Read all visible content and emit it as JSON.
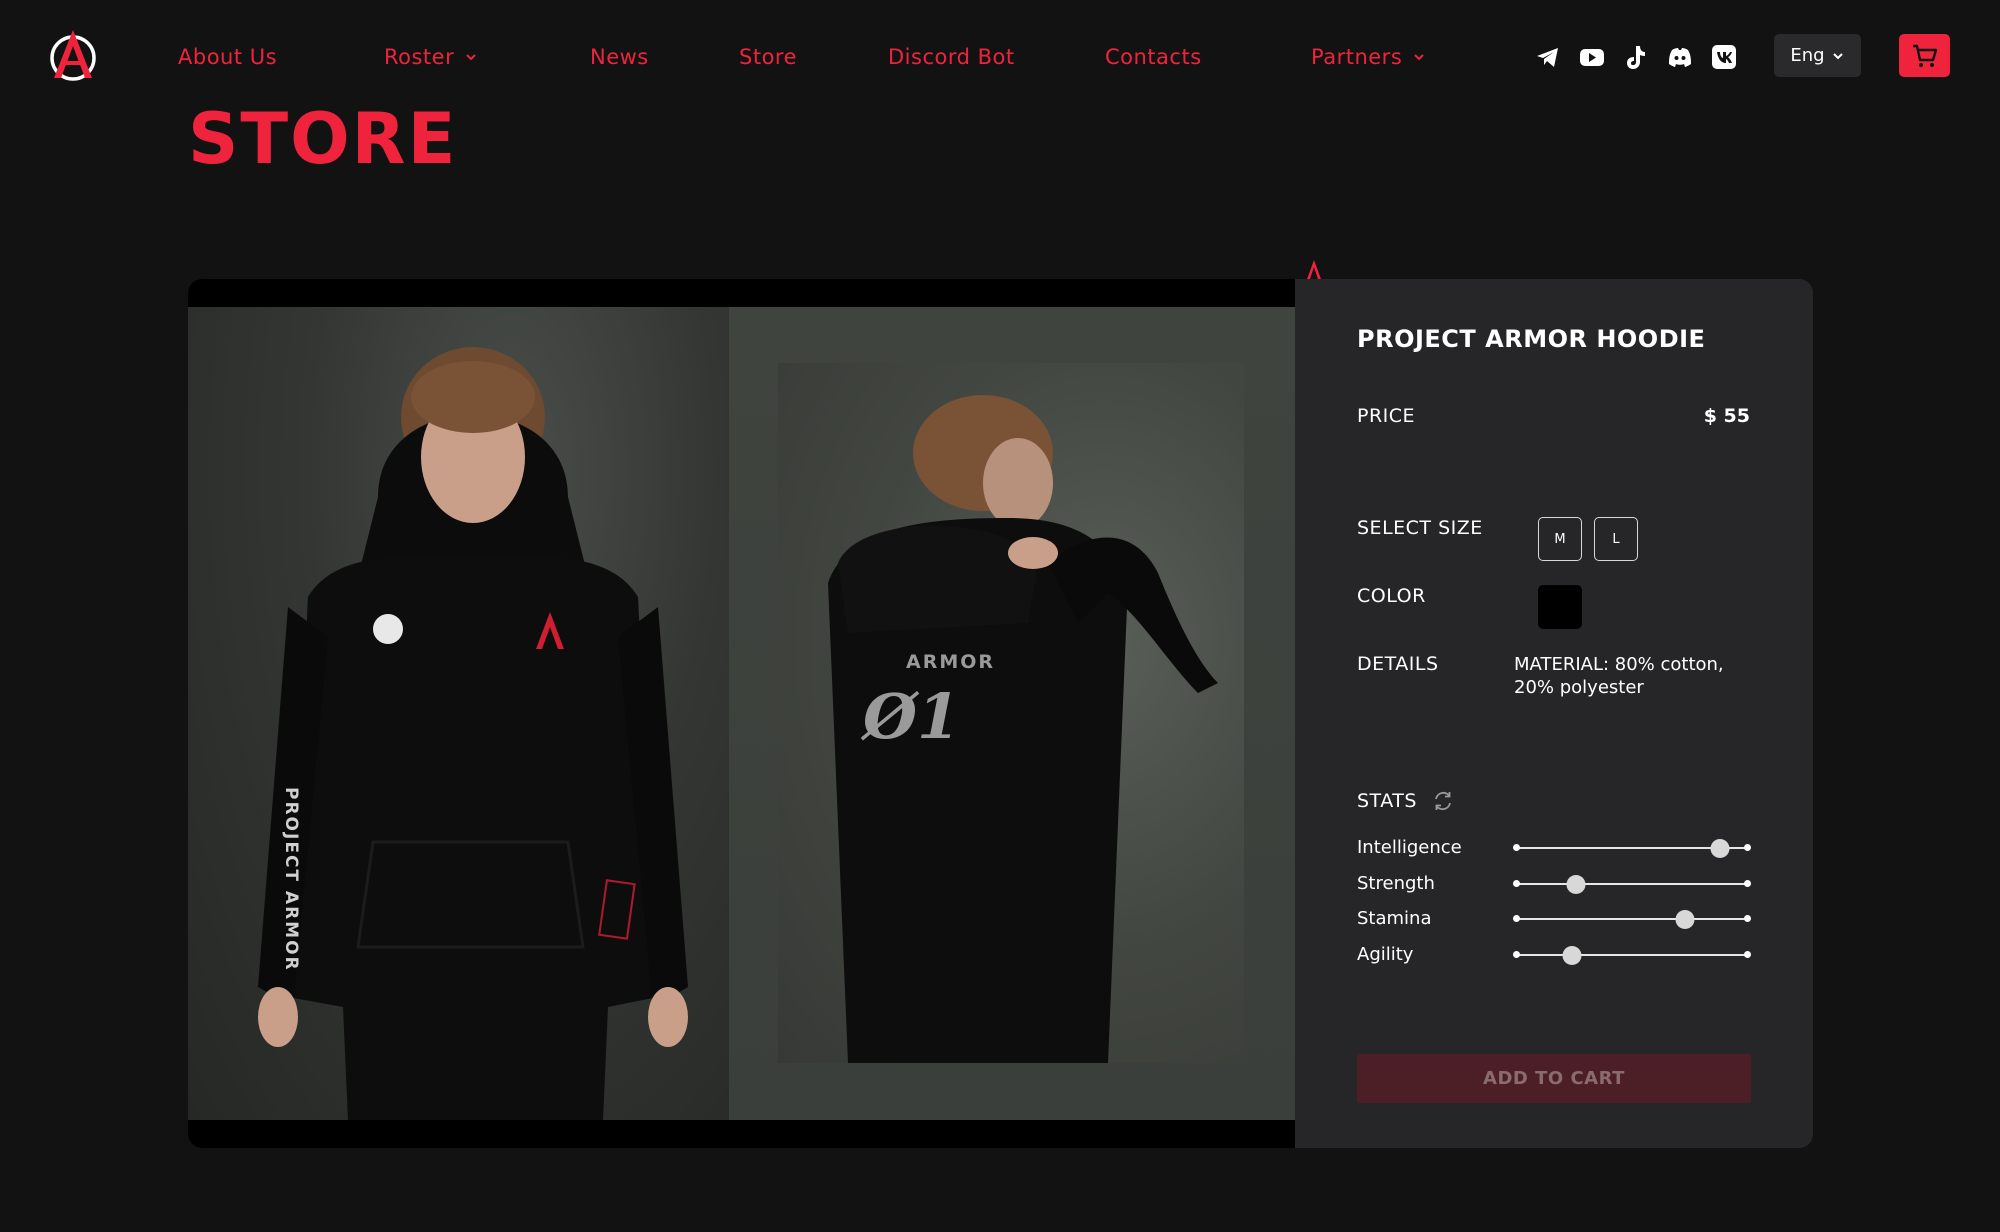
{
  "brand": {
    "accent": "#f0233d",
    "background": "#121213",
    "card": "#262628"
  },
  "nav": {
    "items": [
      {
        "label": "About Us",
        "dropdown": false
      },
      {
        "label": "Roster",
        "dropdown": true
      },
      {
        "label": "News",
        "dropdown": false
      },
      {
        "label": "Store",
        "dropdown": false
      },
      {
        "label": "Discord Bot",
        "dropdown": false
      },
      {
        "label": "Contacts",
        "dropdown": false
      },
      {
        "label": "Partners",
        "dropdown": true
      }
    ],
    "social_icons": [
      "telegram-icon",
      "youtube-icon",
      "tiktok-icon",
      "discord-icon",
      "vk-icon"
    ],
    "language": "Eng"
  },
  "page": {
    "title": "STORE"
  },
  "product": {
    "name": "PROJECT ARMOR HOODIE",
    "price_label": "PRICE",
    "price": "$ 55",
    "size_label": "SELECT SIZE",
    "sizes": [
      "M",
      "L"
    ],
    "color_label": "COLOR",
    "color_value": "#000000",
    "details_label": "DETAILS",
    "details_value": "MATERIAL: 80% cotton, 20% polyester",
    "stats_label": "STATS",
    "stats": [
      {
        "name": "Intelligence",
        "value": 0.88
      },
      {
        "name": "Strength",
        "value": 0.26
      },
      {
        "name": "Stamina",
        "value": 0.73
      },
      {
        "name": "Agility",
        "value": 0.24
      }
    ],
    "add_to_cart": "ADD TO CART",
    "print": {
      "back_top": "ARMOR",
      "back_number": "Ø1",
      "sleeve": "PROJECT ARMOR"
    }
  }
}
